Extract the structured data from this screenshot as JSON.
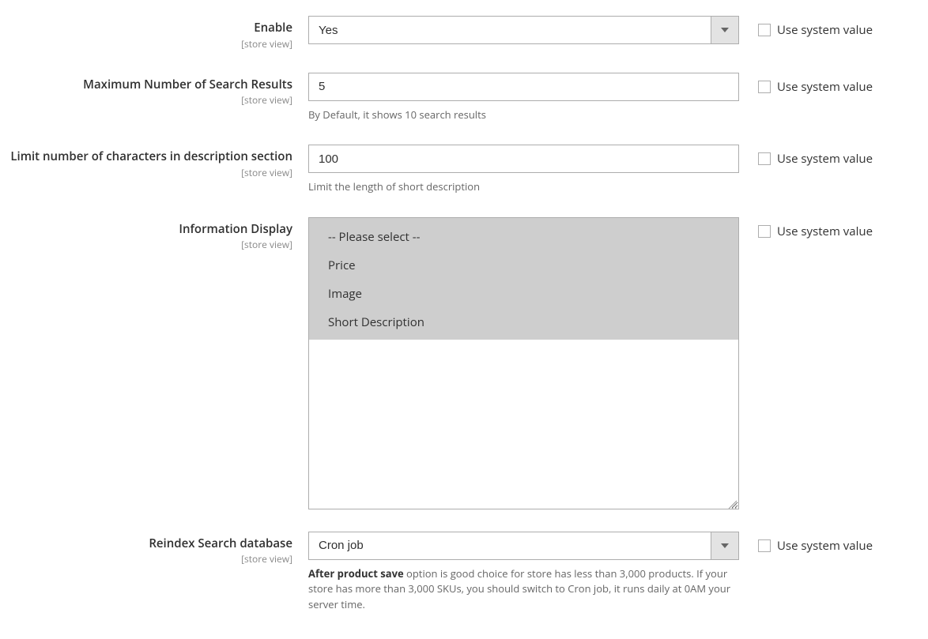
{
  "common": {
    "scope": "[store view]",
    "use_system": "Use system value"
  },
  "enable": {
    "label": "Enable",
    "value": "Yes"
  },
  "max_results": {
    "label": "Maximum Number of Search Results",
    "value": "5",
    "note": "By Default, it shows 10 search results"
  },
  "limit_chars": {
    "label": "Limit number of characters in description section",
    "value": "100",
    "note": "Limit the length of short description"
  },
  "info_display": {
    "label": "Information Display",
    "options": {
      "0": "-- Please select --",
      "1": "Price",
      "2": "Image",
      "3": "Short Description"
    }
  },
  "reindex": {
    "label": "Reindex Search database",
    "value": "Cron job",
    "note_strong": "After product save",
    "note_rest": " option is good choice for store has less than 3,000 products. If your store has more than 3,000 SKUs, you should switch to Cron job, it runs daily at 0AM your server time."
  }
}
